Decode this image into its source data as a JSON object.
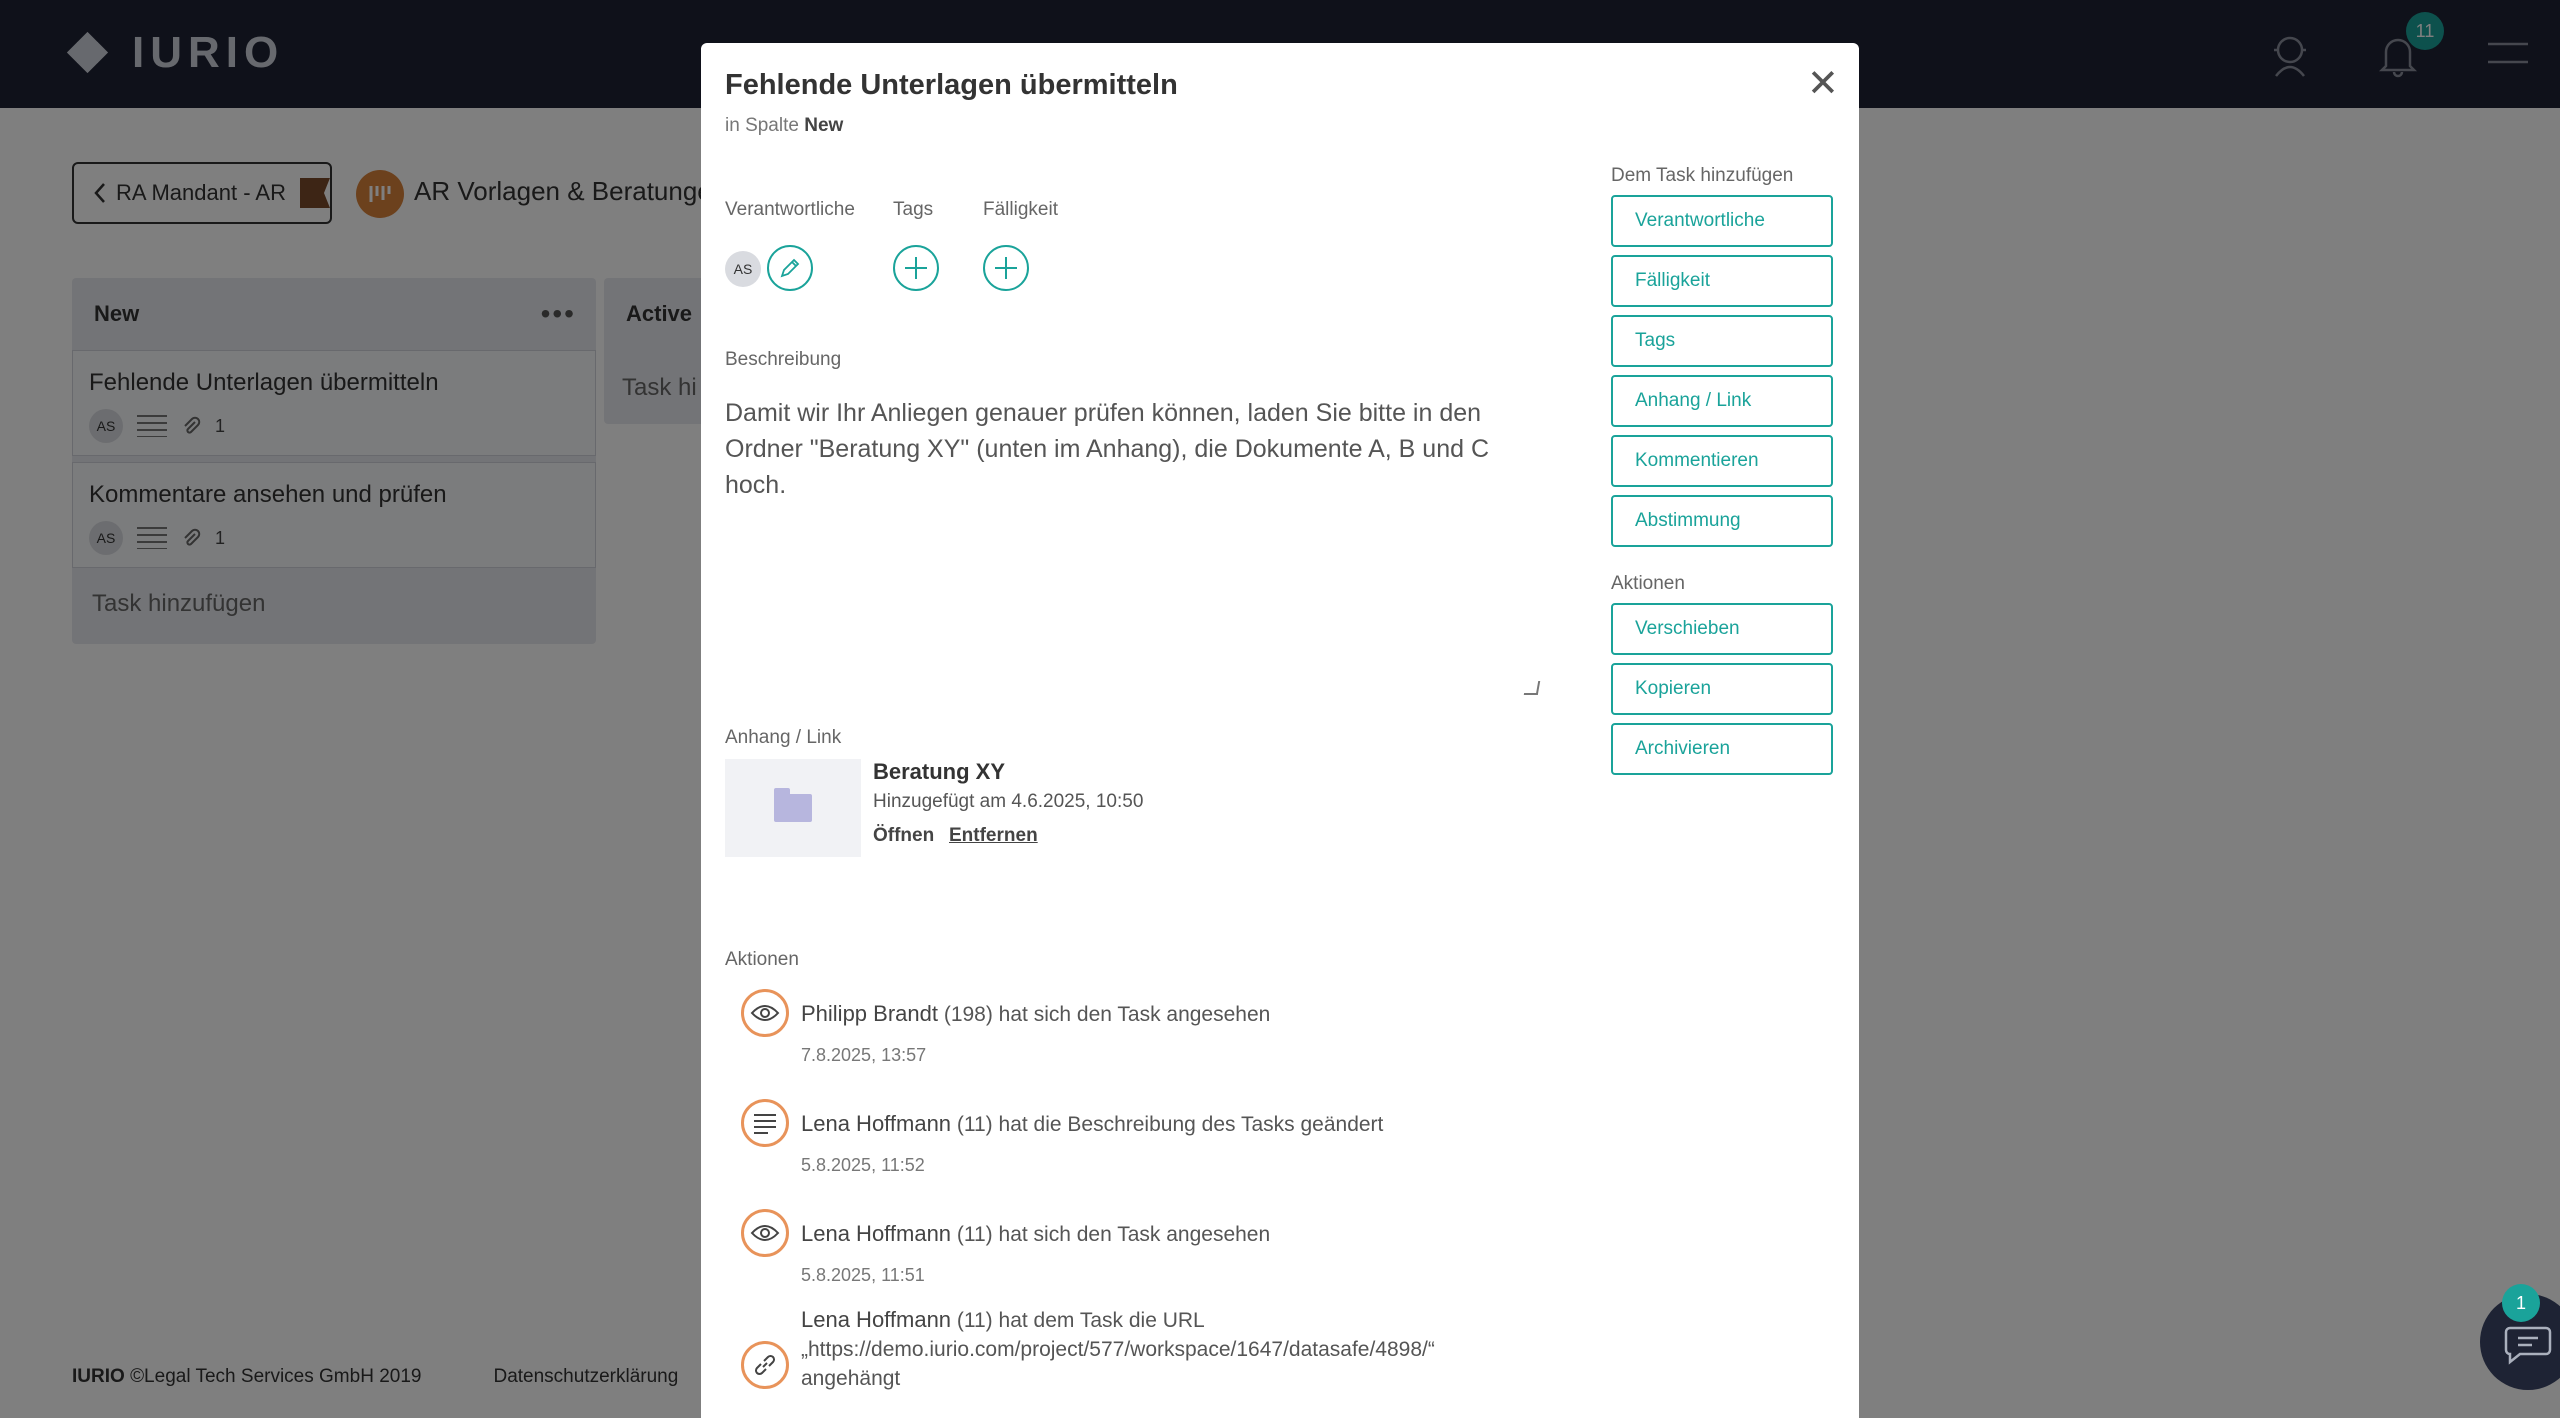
{
  "app": {
    "logo_text": "IURIO",
    "notifications_count": "11",
    "chat_badge": "1"
  },
  "breadcrumb": {
    "back_label": "RA Mandant - AR",
    "project_initials": "",
    "project_title": "AR Vorlagen & Beratungen"
  },
  "board": {
    "columns": [
      {
        "title": "New",
        "cards": [
          {
            "title": "Fehlende Unterlagen übermitteln",
            "avatar": "AS",
            "attachments": "1"
          },
          {
            "title": "Kommentare ansehen und prüfen",
            "avatar": "AS",
            "attachments": "1"
          }
        ],
        "add_label": "Task hinzufügen"
      },
      {
        "title": "Active",
        "add_label": "Task hi"
      }
    ]
  },
  "footer": {
    "brand": "IURIO",
    "copyright": "©Legal Tech Services GmbH 2019",
    "privacy": "Datenschutzerklärung"
  },
  "modal": {
    "title": "Fehlende Unterlagen übermitteln",
    "column_prefix": "in Spalte",
    "column_name": "New",
    "labels": {
      "responsible": "Verantwortliche",
      "tags": "Tags",
      "due": "Fälligkeit",
      "description": "Beschreibung",
      "attachment": "Anhang / Link",
      "actions": "Aktionen"
    },
    "responsible_avatar": "AS",
    "description": "Damit wir Ihr Anliegen genauer prüfen können, laden Sie bitte in den Ordner \"Beratung XY\" (unten im Anhang), die Dokumente A, B und C hoch.",
    "attachment": {
      "name": "Beratung XY",
      "added": "Hinzugefügt am 4.6.2025, 10:50",
      "open": "Öffnen",
      "remove": "Entfernen"
    },
    "activity": [
      {
        "icon": "eye-icon",
        "name": "Philipp Brandt",
        "text": "(198) hat sich den Task angesehen",
        "time": "7.8.2025, 13:57"
      },
      {
        "icon": "lines-icon",
        "name": "Lena Hoffmann",
        "text": "(11) hat die Beschreibung des Tasks geändert",
        "time": "5.8.2025, 11:52"
      },
      {
        "icon": "eye-icon",
        "name": "Lena Hoffmann",
        "text": "(11) hat sich den Task angesehen",
        "time": "5.8.2025, 11:51"
      },
      {
        "icon": "link-icon",
        "name": "Lena Hoffmann",
        "text": "(11) hat dem Task die URL „https://demo.iurio.com/project/577/workspace/1647/datasafe/4898/“ angehängt",
        "time": ""
      }
    ],
    "sidebar": {
      "add_heading": "Dem Task hinzufügen",
      "add_buttons": [
        "Verantwortliche",
        "Fälligkeit",
        "Tags",
        "Anhang / Link",
        "Kommentieren",
        "Abstimmung"
      ],
      "actions_heading": "Aktionen",
      "action_buttons": [
        "Verschieben",
        "Kopieren",
        "Archivieren"
      ]
    }
  },
  "colors": {
    "topbar": "#1e2334",
    "accent": "#1aa39a",
    "activity_ring": "#e8935a"
  }
}
